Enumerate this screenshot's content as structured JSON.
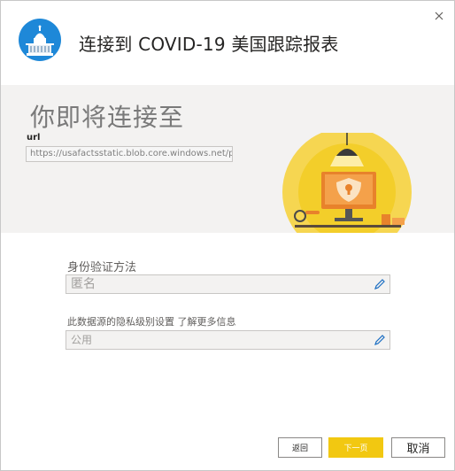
{
  "dialog": {
    "title": "连接到 COVID-19 美国跟踪报表",
    "close_icon": "close-icon",
    "header_icon": "capitol-building-icon"
  },
  "band": {
    "heading": "你即将连接至",
    "url_label": "url",
    "url_value": "https://usafactsstatic.blob.core.windows.net/publ",
    "illustration": "security-shield-computer-illustration"
  },
  "auth": {
    "label": "身份验证方法",
    "value": "匿名",
    "edit_icon": "pencil-icon"
  },
  "privacy": {
    "label": "此数据源的隐私级别设置 了解更多信息",
    "value": "公用",
    "edit_icon": "pencil-icon"
  },
  "buttons": {
    "back": "返回",
    "next": "下一页",
    "cancel": "取消"
  },
  "colors": {
    "accent": "#f2c811",
    "header_icon_bg": "#1e88d8",
    "band_bg": "#f3f2f1",
    "illustration_orange": "#e8822b"
  }
}
